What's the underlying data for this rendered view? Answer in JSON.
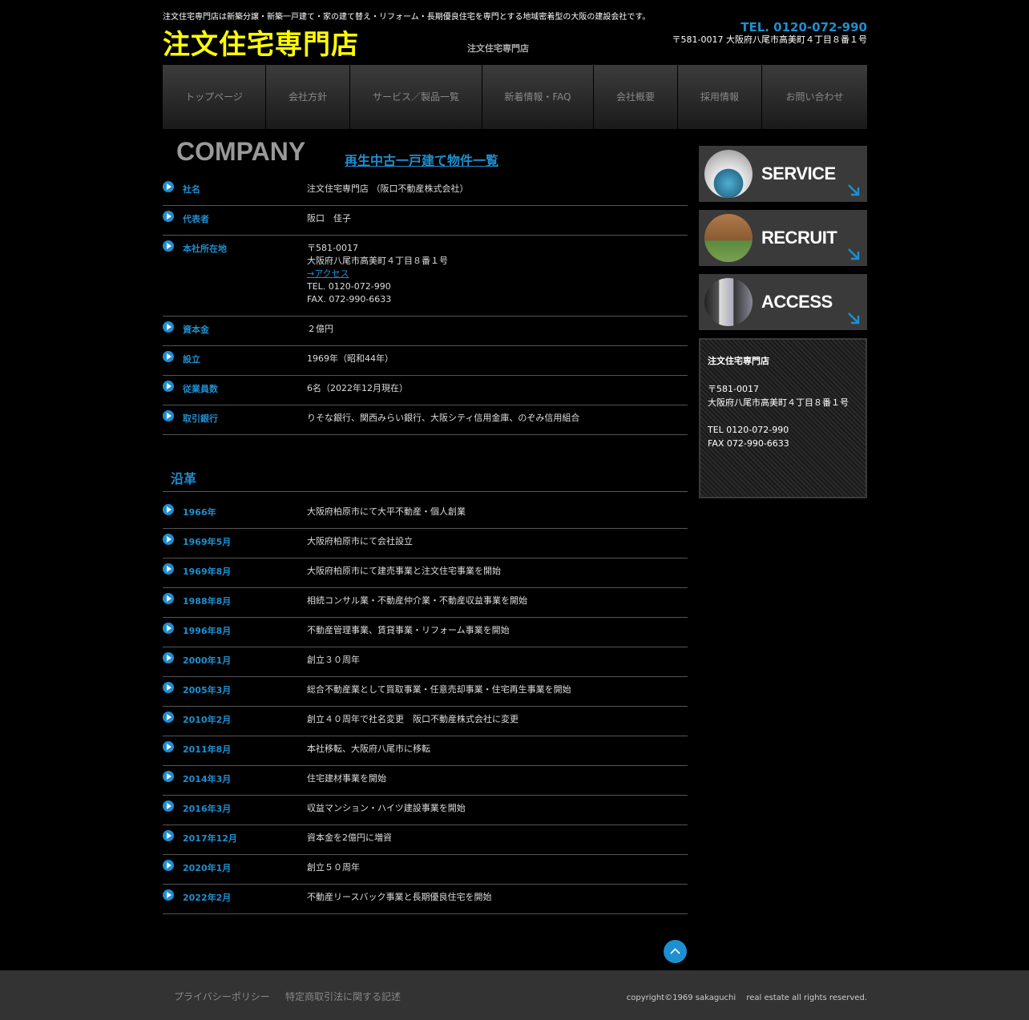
{
  "header": {
    "tagline": "注文住宅専門店は新築分譲・新築一戸建て・家の建て替え・リフォーム・長期優良住宅を専門とする地域密着型の大阪の建設会社です。",
    "logo": "注文住宅専門店",
    "subname": "注文住宅専門店",
    "tel": "TEL. 0120-072-990",
    "address": "〒581-0017 大阪府八尾市高美町４丁目８番１号"
  },
  "nav": [
    {
      "label": "トップページ"
    },
    {
      "label": "会社方針"
    },
    {
      "label": "サービス／製品一覧"
    },
    {
      "label": "新着情報・FAQ"
    },
    {
      "label": "会社概要"
    },
    {
      "label": "採用情報"
    },
    {
      "label": "お問い合わせ"
    }
  ],
  "main": {
    "heading": "COMPANY",
    "heading_link": "再生中古一戸建て物件一覧"
  },
  "company": {
    "name_label": "社名",
    "name_value": "注文住宅専門店 （阪口不動産株式会社）",
    "rep_label": "代表者",
    "rep_value": "阪口　佳子",
    "addr_label": "本社所在地",
    "addr_zip": "〒581-0017",
    "addr_line": "大阪府八尾市高美町４丁目８番１号",
    "addr_access": "→アクセス",
    "addr_tel": "TEL. 0120-072-990",
    "addr_fax": "FAX. 072-990-6633",
    "capital_label": "資本金",
    "capital_value": "２億円",
    "founded_label": "設立",
    "founded_value": "1969年（昭和44年）",
    "staff_label": "従業員数",
    "staff_value": "6名（2022年12月現在）",
    "bank_label": "取引銀行",
    "bank_value": "りそな銀行、関西みらい銀行、大阪シティ信用金庫、のぞみ信用組合"
  },
  "history": {
    "title": "沿革",
    "items": [
      {
        "date": "1966年",
        "text": "大阪府柏原市にて大平不動産・個人創業"
      },
      {
        "date": "1969年5月",
        "text": "大阪府柏原市にて会社設立"
      },
      {
        "date": "1969年8月",
        "text": "大阪府柏原市にて建売事業と注文住宅事業を開始"
      },
      {
        "date": "1988年8月",
        "text": "相続コンサル業・不動産仲介業・不動産収益事業を開始"
      },
      {
        "date": "1996年8月",
        "text": "不動産管理事業、賃貸事業・リフォーム事業を開始"
      },
      {
        "date": "2000年1月",
        "text": "創立３０周年"
      },
      {
        "date": "2005年3月",
        "text": "総合不動産業として買取事業・任意売却事業・住宅再生事業を開始"
      },
      {
        "date": "2010年2月",
        "text": "創立４０周年で社名変更　阪口不動産株式会社に変更"
      },
      {
        "date": "2011年8月",
        "text": "本社移転、大阪府八尾市に移転"
      },
      {
        "date": "2014年3月",
        "text": "住宅建材事業を開始"
      },
      {
        "date": "2016年3月",
        "text": "収益マンション・ハイツ建設事業を開始"
      },
      {
        "date": "2017年12月",
        "text": "資本金を2億円に増資"
      },
      {
        "date": "2020年1月",
        "text": "創立５０周年"
      },
      {
        "date": "2022年2月",
        "text": "不動産リースバック事業と長期優良住宅を開始"
      }
    ]
  },
  "sidebar": {
    "banners": [
      {
        "title": "SERVICE",
        "color": "#5fa0b8"
      },
      {
        "title": "RECRUIT",
        "color": "#a0704a"
      },
      {
        "title": "ACCESS",
        "color": "#8a9aa8"
      }
    ],
    "info": {
      "name": "注文住宅専門店",
      "zip": "〒581-0017",
      "address": "大阪府八尾市高美町４丁目８番１号",
      "tel": "TEL 0120-072-990",
      "fax": "FAX 072-990-6633"
    }
  },
  "footer": {
    "privacy": "プライバシーポリシー",
    "tokutei": "特定商取引法に関する記述",
    "copyright": "copyright©1969 sakaguchi　 real estate all rights reserved."
  },
  "colors": {
    "accent": "#1e8fd0",
    "logo": "#ffff00"
  }
}
